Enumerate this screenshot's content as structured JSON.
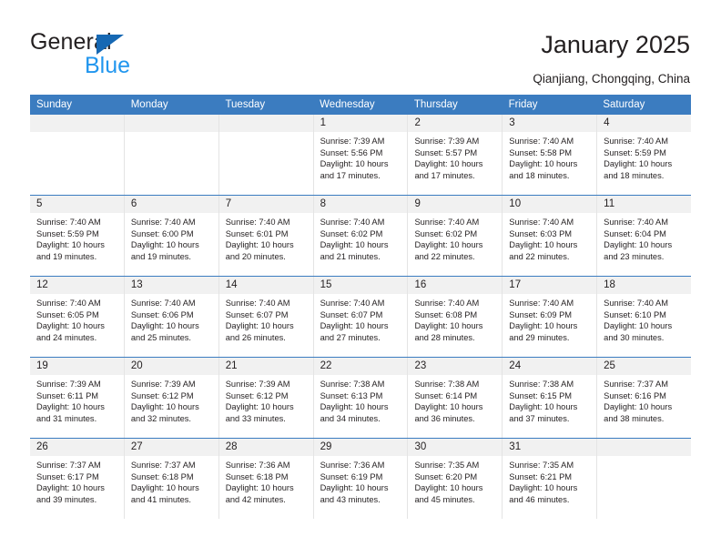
{
  "brand": {
    "name_part1": "General",
    "name_part2": "Blue",
    "accent_color": "#1668b3",
    "accent_color_light": "#2196ee"
  },
  "header": {
    "title": "January 2025",
    "location": "Qianjiang, Chongqing, China"
  },
  "calendar": {
    "header_bg": "#3b7cc0",
    "daynum_bg": "#f1f1f1",
    "weekdays": [
      "Sunday",
      "Monday",
      "Tuesday",
      "Wednesday",
      "Thursday",
      "Friday",
      "Saturday"
    ],
    "weeks": [
      [
        {
          "day": "",
          "empty": true
        },
        {
          "day": "",
          "empty": true
        },
        {
          "day": "",
          "empty": true
        },
        {
          "day": "1",
          "sunrise": "Sunrise: 7:39 AM",
          "sunset": "Sunset: 5:56 PM",
          "daylight": "Daylight: 10 hours and 17 minutes."
        },
        {
          "day": "2",
          "sunrise": "Sunrise: 7:39 AM",
          "sunset": "Sunset: 5:57 PM",
          "daylight": "Daylight: 10 hours and 17 minutes."
        },
        {
          "day": "3",
          "sunrise": "Sunrise: 7:40 AM",
          "sunset": "Sunset: 5:58 PM",
          "daylight": "Daylight: 10 hours and 18 minutes."
        },
        {
          "day": "4",
          "sunrise": "Sunrise: 7:40 AM",
          "sunset": "Sunset: 5:59 PM",
          "daylight": "Daylight: 10 hours and 18 minutes."
        }
      ],
      [
        {
          "day": "5",
          "sunrise": "Sunrise: 7:40 AM",
          "sunset": "Sunset: 5:59 PM",
          "daylight": "Daylight: 10 hours and 19 minutes."
        },
        {
          "day": "6",
          "sunrise": "Sunrise: 7:40 AM",
          "sunset": "Sunset: 6:00 PM",
          "daylight": "Daylight: 10 hours and 19 minutes."
        },
        {
          "day": "7",
          "sunrise": "Sunrise: 7:40 AM",
          "sunset": "Sunset: 6:01 PM",
          "daylight": "Daylight: 10 hours and 20 minutes."
        },
        {
          "day": "8",
          "sunrise": "Sunrise: 7:40 AM",
          "sunset": "Sunset: 6:02 PM",
          "daylight": "Daylight: 10 hours and 21 minutes."
        },
        {
          "day": "9",
          "sunrise": "Sunrise: 7:40 AM",
          "sunset": "Sunset: 6:02 PM",
          "daylight": "Daylight: 10 hours and 22 minutes."
        },
        {
          "day": "10",
          "sunrise": "Sunrise: 7:40 AM",
          "sunset": "Sunset: 6:03 PM",
          "daylight": "Daylight: 10 hours and 22 minutes."
        },
        {
          "day": "11",
          "sunrise": "Sunrise: 7:40 AM",
          "sunset": "Sunset: 6:04 PM",
          "daylight": "Daylight: 10 hours and 23 minutes."
        }
      ],
      [
        {
          "day": "12",
          "sunrise": "Sunrise: 7:40 AM",
          "sunset": "Sunset: 6:05 PM",
          "daylight": "Daylight: 10 hours and 24 minutes."
        },
        {
          "day": "13",
          "sunrise": "Sunrise: 7:40 AM",
          "sunset": "Sunset: 6:06 PM",
          "daylight": "Daylight: 10 hours and 25 minutes."
        },
        {
          "day": "14",
          "sunrise": "Sunrise: 7:40 AM",
          "sunset": "Sunset: 6:07 PM",
          "daylight": "Daylight: 10 hours and 26 minutes."
        },
        {
          "day": "15",
          "sunrise": "Sunrise: 7:40 AM",
          "sunset": "Sunset: 6:07 PM",
          "daylight": "Daylight: 10 hours and 27 minutes."
        },
        {
          "day": "16",
          "sunrise": "Sunrise: 7:40 AM",
          "sunset": "Sunset: 6:08 PM",
          "daylight": "Daylight: 10 hours and 28 minutes."
        },
        {
          "day": "17",
          "sunrise": "Sunrise: 7:40 AM",
          "sunset": "Sunset: 6:09 PM",
          "daylight": "Daylight: 10 hours and 29 minutes."
        },
        {
          "day": "18",
          "sunrise": "Sunrise: 7:40 AM",
          "sunset": "Sunset: 6:10 PM",
          "daylight": "Daylight: 10 hours and 30 minutes."
        }
      ],
      [
        {
          "day": "19",
          "sunrise": "Sunrise: 7:39 AM",
          "sunset": "Sunset: 6:11 PM",
          "daylight": "Daylight: 10 hours and 31 minutes."
        },
        {
          "day": "20",
          "sunrise": "Sunrise: 7:39 AM",
          "sunset": "Sunset: 6:12 PM",
          "daylight": "Daylight: 10 hours and 32 minutes."
        },
        {
          "day": "21",
          "sunrise": "Sunrise: 7:39 AM",
          "sunset": "Sunset: 6:12 PM",
          "daylight": "Daylight: 10 hours and 33 minutes."
        },
        {
          "day": "22",
          "sunrise": "Sunrise: 7:38 AM",
          "sunset": "Sunset: 6:13 PM",
          "daylight": "Daylight: 10 hours and 34 minutes."
        },
        {
          "day": "23",
          "sunrise": "Sunrise: 7:38 AM",
          "sunset": "Sunset: 6:14 PM",
          "daylight": "Daylight: 10 hours and 36 minutes."
        },
        {
          "day": "24",
          "sunrise": "Sunrise: 7:38 AM",
          "sunset": "Sunset: 6:15 PM",
          "daylight": "Daylight: 10 hours and 37 minutes."
        },
        {
          "day": "25",
          "sunrise": "Sunrise: 7:37 AM",
          "sunset": "Sunset: 6:16 PM",
          "daylight": "Daylight: 10 hours and 38 minutes."
        }
      ],
      [
        {
          "day": "26",
          "sunrise": "Sunrise: 7:37 AM",
          "sunset": "Sunset: 6:17 PM",
          "daylight": "Daylight: 10 hours and 39 minutes."
        },
        {
          "day": "27",
          "sunrise": "Sunrise: 7:37 AM",
          "sunset": "Sunset: 6:18 PM",
          "daylight": "Daylight: 10 hours and 41 minutes."
        },
        {
          "day": "28",
          "sunrise": "Sunrise: 7:36 AM",
          "sunset": "Sunset: 6:18 PM",
          "daylight": "Daylight: 10 hours and 42 minutes."
        },
        {
          "day": "29",
          "sunrise": "Sunrise: 7:36 AM",
          "sunset": "Sunset: 6:19 PM",
          "daylight": "Daylight: 10 hours and 43 minutes."
        },
        {
          "day": "30",
          "sunrise": "Sunrise: 7:35 AM",
          "sunset": "Sunset: 6:20 PM",
          "daylight": "Daylight: 10 hours and 45 minutes."
        },
        {
          "day": "31",
          "sunrise": "Sunrise: 7:35 AM",
          "sunset": "Sunset: 6:21 PM",
          "daylight": "Daylight: 10 hours and 46 minutes."
        },
        {
          "day": "",
          "empty": true
        }
      ]
    ]
  }
}
